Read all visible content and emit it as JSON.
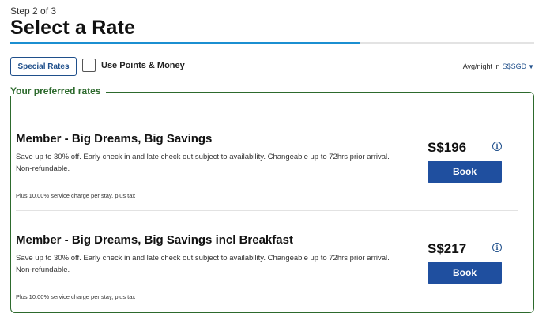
{
  "header": {
    "step_label": "Step 2 of 3",
    "title": "Select a Rate",
    "progress_fraction": 0.667,
    "progress_color": "#1b8fd1"
  },
  "filters": {
    "special_rates_label": "Special Rates",
    "points_money_label": "Use Points & Money",
    "points_money_checked": false
  },
  "currency_display": {
    "prefix": "Avg/night in",
    "currency": "S$SGD",
    "dropdown_icon": "caret-down-icon"
  },
  "preferred_rates": {
    "legend": "Your preferred rates",
    "border_color": "#2d6a2d",
    "rates": [
      {
        "name": "Member - Big Dreams, Big Savings",
        "description": "Save up to 30% off. Early check in and late check out subject to availability. Changeable up to 72hrs prior arrival. Non-refundable.",
        "fine_print": "Plus 10.00% service charge per stay, plus tax",
        "price": "S$196",
        "book_label": "Book"
      },
      {
        "name": "Member - Big Dreams, Big Savings incl Breakfast",
        "description": "Save up to 30% off. Early check in and late check out subject to availability. Changeable up to 72hrs prior arrival. Non-refundable.",
        "fine_print": "Plus 10.00% service charge per stay, plus tax",
        "price": "S$217",
        "book_label": "Book"
      }
    ]
  },
  "colors": {
    "brand_blue": "#1f4f9f",
    "link_blue": "#1f4f8b"
  }
}
